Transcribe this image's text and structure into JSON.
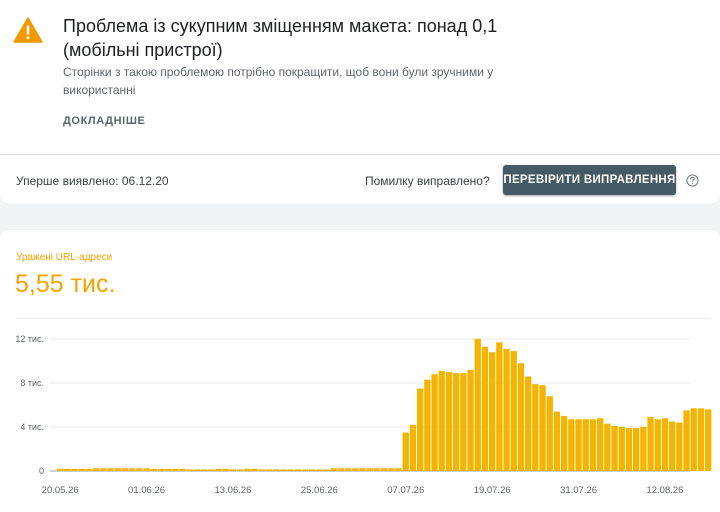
{
  "issue": {
    "title": "Проблема із сукупним зміщенням макета: понад 0,1 (мобільні пристрої)",
    "description": "Сторінки з такою проблемою потрібно покращити, щоб вони були зручними у використанні",
    "more_label": "ДОКЛАДНІШЕ",
    "icon": "warning-icon",
    "icon_color": "#f29900"
  },
  "status_bar": {
    "first_detected": "Уперше виявлено: 06.12.20",
    "fixed_question": "Помилку виправлено?",
    "validate_label": "ПЕРЕВІРИТИ ВИПРАВЛЕННЯ",
    "help_icon": "help-circle-icon"
  },
  "metric": {
    "label": "Уражені URL-адреси",
    "value": "5,55 тис.",
    "color": "#f4a300"
  },
  "chart_data": {
    "type": "bar",
    "color": "#f4b400",
    "grid": true,
    "ylim": [
      0,
      13000
    ],
    "y_ticks": [
      {
        "value": 0,
        "label": "0"
      },
      {
        "value": 4000,
        "label": "4 тис."
      },
      {
        "value": 8000,
        "label": "8 тис."
      },
      {
        "value": 12000,
        "label": "12 тис."
      }
    ],
    "x_tick_labels": [
      "20.05.26",
      "01.06.26",
      "13.06.26",
      "25.06.26",
      "07.07.26",
      "19.07.26",
      "31.07.26",
      "12.08.26"
    ],
    "x_tick_indices": [
      0,
      12,
      24,
      36,
      48,
      60,
      72,
      84
    ],
    "values": [
      200,
      200,
      200,
      200,
      200,
      250,
      250,
      250,
      250,
      250,
      250,
      250,
      250,
      200,
      200,
      200,
      200,
      200,
      150,
      150,
      150,
      150,
      200,
      200,
      150,
      150,
      200,
      200,
      150,
      150,
      150,
      150,
      150,
      150,
      150,
      150,
      150,
      150,
      250,
      250,
      250,
      250,
      250,
      250,
      250,
      250,
      250,
      250,
      3500,
      4200,
      7500,
      8300,
      8800,
      9100,
      9000,
      8900,
      8900,
      9200,
      12000,
      11300,
      10800,
      11700,
      11100,
      10900,
      9800,
      8600,
      7900,
      7800,
      6800,
      5400,
      5000,
      4700,
      4700,
      4700,
      4700,
      4800,
      4300,
      4100,
      4000,
      3900,
      3900,
      4000,
      4900,
      4700,
      4800,
      4500,
      4400,
      5500,
      5700,
      5700,
      5600
    ]
  }
}
